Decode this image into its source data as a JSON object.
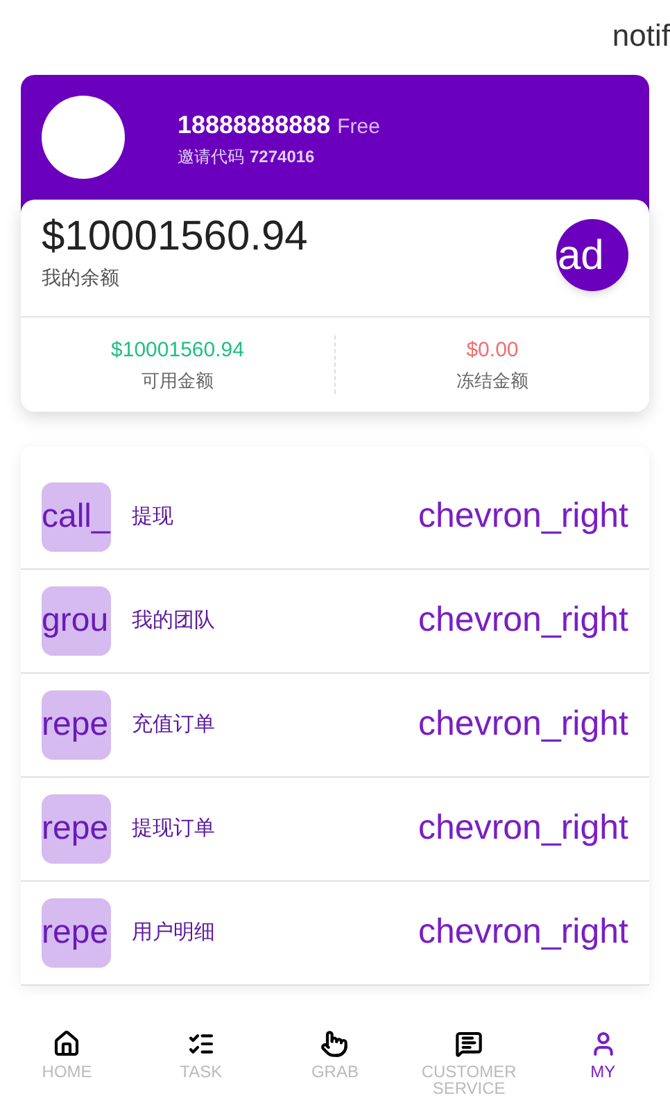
{
  "top_bar": {
    "text": "notif"
  },
  "profile": {
    "phone": "18888888888",
    "badge": "Free",
    "invite_label": "邀请代码",
    "invite_code": "7274016"
  },
  "balance": {
    "amount": "$10001560.94",
    "label": "我的余额",
    "action_text": "ad",
    "available": {
      "amount": "$10001560.94",
      "label": "可用金额"
    },
    "frozen": {
      "amount": "$0.00",
      "label": "冻结金额"
    }
  },
  "menu": [
    {
      "icon_text": "call_",
      "label": "提现",
      "chevron_text": "chevron_right"
    },
    {
      "icon_text": "grou",
      "label": "我的团队",
      "chevron_text": "chevron_right"
    },
    {
      "icon_text": "repe",
      "label": "充值订单",
      "chevron_text": "chevron_right"
    },
    {
      "icon_text": "repe",
      "label": "提现订单",
      "chevron_text": "chevron_right"
    },
    {
      "icon_text": "repe",
      "label": "用户明细",
      "chevron_text": "chevron_right"
    }
  ],
  "bottom_nav": [
    {
      "label": "HOME",
      "selected": false
    },
    {
      "label": "TASK",
      "selected": false
    },
    {
      "label": "GRAB",
      "selected": false
    },
    {
      "label": "CUSTOMER SERVICE",
      "selected": false
    },
    {
      "label": "MY",
      "selected": true
    }
  ]
}
